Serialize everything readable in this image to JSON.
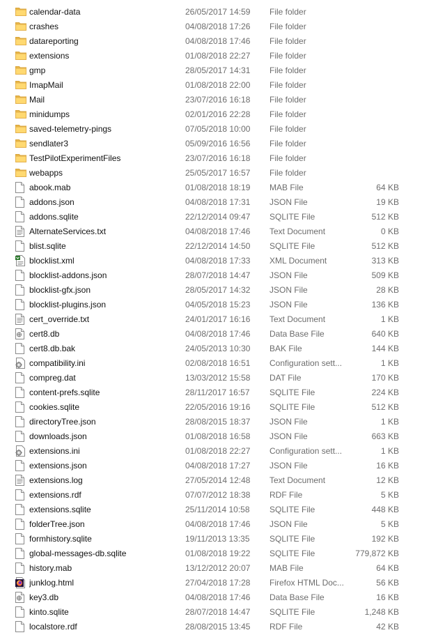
{
  "files": [
    {
      "name": "calendar-data",
      "date": "26/05/2017 14:59",
      "type": "File folder",
      "size": "",
      "icon": "folder-icon"
    },
    {
      "name": "crashes",
      "date": "04/08/2018 17:26",
      "type": "File folder",
      "size": "",
      "icon": "folder-icon"
    },
    {
      "name": "datareporting",
      "date": "04/08/2018 17:46",
      "type": "File folder",
      "size": "",
      "icon": "folder-icon"
    },
    {
      "name": "extensions",
      "date": "01/08/2018 22:27",
      "type": "File folder",
      "size": "",
      "icon": "folder-icon"
    },
    {
      "name": "gmp",
      "date": "28/05/2017 14:31",
      "type": "File folder",
      "size": "",
      "icon": "folder-icon"
    },
    {
      "name": "ImapMail",
      "date": "01/08/2018 22:00",
      "type": "File folder",
      "size": "",
      "icon": "folder-icon"
    },
    {
      "name": "Mail",
      "date": "23/07/2016 16:18",
      "type": "File folder",
      "size": "",
      "icon": "folder-icon"
    },
    {
      "name": "minidumps",
      "date": "02/01/2016 22:28",
      "type": "File folder",
      "size": "",
      "icon": "folder-icon"
    },
    {
      "name": "saved-telemetry-pings",
      "date": "07/05/2018 10:00",
      "type": "File folder",
      "size": "",
      "icon": "folder-icon"
    },
    {
      "name": "sendlater3",
      "date": "05/09/2016 16:56",
      "type": "File folder",
      "size": "",
      "icon": "folder-icon"
    },
    {
      "name": "TestPilotExperimentFiles",
      "date": "23/07/2016 16:18",
      "type": "File folder",
      "size": "",
      "icon": "folder-icon"
    },
    {
      "name": "webapps",
      "date": "25/05/2017 16:57",
      "type": "File folder",
      "size": "",
      "icon": "folder-icon"
    },
    {
      "name": "abook.mab",
      "date": "01/08/2018 18:19",
      "type": "MAB File",
      "size": "64 KB",
      "icon": "file-icon"
    },
    {
      "name": "addons.json",
      "date": "04/08/2018 17:31",
      "type": "JSON File",
      "size": "19 KB",
      "icon": "file-icon"
    },
    {
      "name": "addons.sqlite",
      "date": "22/12/2014 09:47",
      "type": "SQLITE File",
      "size": "512 KB",
      "icon": "file-icon"
    },
    {
      "name": "AlternateServices.txt",
      "date": "04/08/2018 17:46",
      "type": "Text Document",
      "size": "0 KB",
      "icon": "text-file-icon"
    },
    {
      "name": "blist.sqlite",
      "date": "22/12/2014 14:50",
      "type": "SQLITE File",
      "size": "512 KB",
      "icon": "file-icon"
    },
    {
      "name": "blocklist.xml",
      "date": "04/08/2018 17:33",
      "type": "XML Document",
      "size": "313 KB",
      "icon": "xml-file-icon"
    },
    {
      "name": "blocklist-addons.json",
      "date": "28/07/2018 14:47",
      "type": "JSON File",
      "size": "509 KB",
      "icon": "file-icon"
    },
    {
      "name": "blocklist-gfx.json",
      "date": "28/05/2017 14:32",
      "type": "JSON File",
      "size": "28 KB",
      "icon": "file-icon"
    },
    {
      "name": "blocklist-plugins.json",
      "date": "04/05/2018 15:23",
      "type": "JSON File",
      "size": "136 KB",
      "icon": "file-icon"
    },
    {
      "name": "cert_override.txt",
      "date": "24/01/2017 16:16",
      "type": "Text Document",
      "size": "1 KB",
      "icon": "text-file-icon"
    },
    {
      "name": "cert8.db",
      "date": "04/08/2018 17:46",
      "type": "Data Base File",
      "size": "640 KB",
      "icon": "database-file-icon"
    },
    {
      "name": "cert8.db.bak",
      "date": "24/05/2013 10:30",
      "type": "BAK File",
      "size": "144 KB",
      "icon": "file-icon"
    },
    {
      "name": "compatibility.ini",
      "date": "02/08/2018 16:51",
      "type": "Configuration sett...",
      "size": "1 KB",
      "icon": "settings-file-icon"
    },
    {
      "name": "compreg.dat",
      "date": "13/03/2012 15:58",
      "type": "DAT File",
      "size": "170 KB",
      "icon": "file-icon"
    },
    {
      "name": "content-prefs.sqlite",
      "date": "28/11/2017 16:57",
      "type": "SQLITE File",
      "size": "224 KB",
      "icon": "file-icon"
    },
    {
      "name": "cookies.sqlite",
      "date": "22/05/2016 19:16",
      "type": "SQLITE File",
      "size": "512 KB",
      "icon": "file-icon"
    },
    {
      "name": "directoryTree.json",
      "date": "28/08/2015 18:37",
      "type": "JSON File",
      "size": "1 KB",
      "icon": "file-icon"
    },
    {
      "name": "downloads.json",
      "date": "01/08/2018 16:58",
      "type": "JSON File",
      "size": "663 KB",
      "icon": "file-icon"
    },
    {
      "name": "extensions.ini",
      "date": "01/08/2018 22:27",
      "type": "Configuration sett...",
      "size": "1 KB",
      "icon": "settings-file-icon"
    },
    {
      "name": "extensions.json",
      "date": "04/08/2018 17:27",
      "type": "JSON File",
      "size": "16 KB",
      "icon": "file-icon"
    },
    {
      "name": "extensions.log",
      "date": "27/05/2014 12:48",
      "type": "Text Document",
      "size": "12 KB",
      "icon": "text-file-icon"
    },
    {
      "name": "extensions.rdf",
      "date": "07/07/2012 18:38",
      "type": "RDF File",
      "size": "5 KB",
      "icon": "file-icon"
    },
    {
      "name": "extensions.sqlite",
      "date": "25/11/2014 10:58",
      "type": "SQLITE File",
      "size": "448 KB",
      "icon": "file-icon"
    },
    {
      "name": "folderTree.json",
      "date": "04/08/2018 17:46",
      "type": "JSON File",
      "size": "5 KB",
      "icon": "file-icon"
    },
    {
      "name": "formhistory.sqlite",
      "date": "19/11/2013 13:35",
      "type": "SQLITE File",
      "size": "192 KB",
      "icon": "file-icon"
    },
    {
      "name": "global-messages-db.sqlite",
      "date": "01/08/2018 19:22",
      "type": "SQLITE File",
      "size": "779,872 KB",
      "icon": "file-icon"
    },
    {
      "name": "history.mab",
      "date": "13/12/2012 20:07",
      "type": "MAB File",
      "size": "64 KB",
      "icon": "file-icon"
    },
    {
      "name": "junklog.html",
      "date": "27/04/2018 17:28",
      "type": "Firefox HTML Doc...",
      "size": "56 KB",
      "icon": "firefox-html-icon"
    },
    {
      "name": "key3.db",
      "date": "04/08/2018 17:46",
      "type": "Data Base File",
      "size": "16 KB",
      "icon": "database-file-icon"
    },
    {
      "name": "kinto.sqlite",
      "date": "28/07/2018 14:47",
      "type": "SQLITE File",
      "size": "1,248 KB",
      "icon": "file-icon"
    },
    {
      "name": "localstore.rdf",
      "date": "28/08/2015 13:45",
      "type": "RDF File",
      "size": "42 KB",
      "icon": "file-icon"
    }
  ]
}
